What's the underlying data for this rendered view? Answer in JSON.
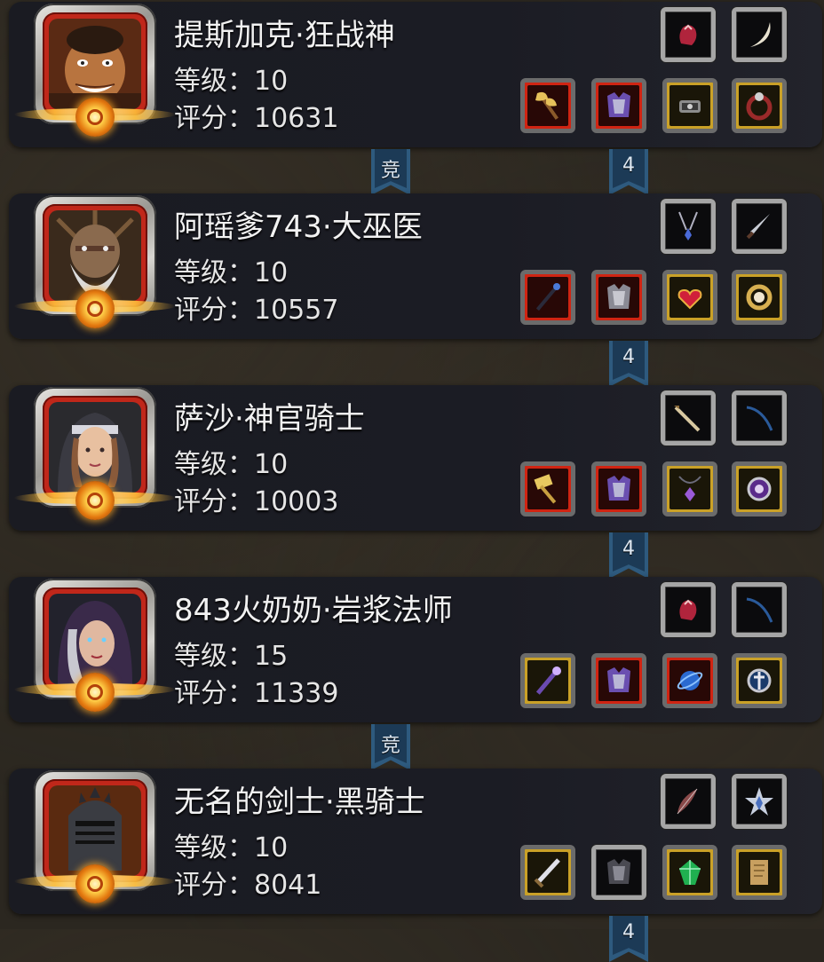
{
  "players": [
    {
      "name": "提斯加克·狂战神",
      "level_text": "等级：10",
      "score_text": "评分：10631",
      "portrait": "barbarian-face",
      "icons": [
        "claw-hand-icon",
        "fang-icon",
        "axe-icon",
        "armor-icon",
        "gear-chest-icon",
        "ring-icon"
      ]
    },
    {
      "name": "阿瑶爹743·大巫医",
      "level_text": "等级：10",
      "score_text": "评分：10557",
      "portrait": "witch-doctor-face",
      "icons": [
        "necklace-icon",
        "dagger-icon",
        "staff-icon",
        "armor-icon",
        "heart-amulet-icon",
        "ring-icon"
      ]
    },
    {
      "name": "萨沙·神官骑士",
      "level_text": "等级：10",
      "score_text": "评分：10003",
      "portrait": "priestess-face",
      "icons": [
        "sword-icon",
        "whip-icon",
        "hammer-icon",
        "armor-icon",
        "amulet-icon",
        "ring-icon"
      ]
    },
    {
      "name": "843火奶奶·岩浆法师",
      "level_text": "等级：15",
      "score_text": "评分：11339",
      "portrait": "sorceress-face",
      "icons": [
        "claw-hand-icon",
        "whip-icon",
        "wand-icon",
        "armor-icon",
        "orb-icon",
        "ring-icon"
      ]
    },
    {
      "name": "无名的剑士·黑骑士",
      "level_text": "等级：10",
      "score_text": "评分：8041",
      "portrait": "black-knight-face",
      "icons": [
        "feather-icon",
        "star-crest-icon",
        "sword-icon",
        "armor-icon",
        "gem-icon",
        "scroll-icon"
      ]
    }
  ],
  "ribbons": [
    {
      "label": "竞"
    },
    {
      "label": "4"
    },
    {
      "label": "4"
    },
    {
      "label": "4"
    },
    {
      "label": "竞"
    },
    {
      "label": "4"
    }
  ],
  "colors": {
    "card": "#1b1c24",
    "ribbon": "#2e5a7e",
    "slot_red": "#d02412",
    "slot_gold": "#caa127"
  }
}
